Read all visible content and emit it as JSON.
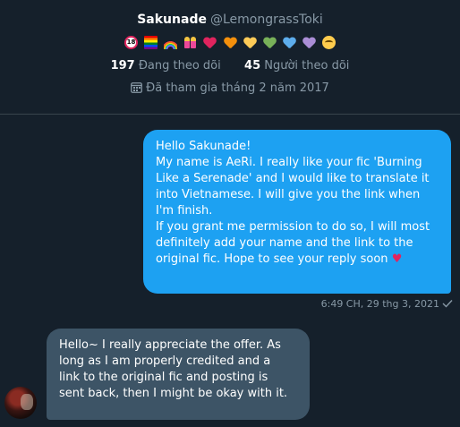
{
  "profile": {
    "display_name": "Sakunade",
    "handle": "@LemongrassToki",
    "bio_emojis": [
      "no-under-18-icon",
      "rainbow-flag-icon",
      "rainbow-icon",
      "couple-icon",
      "red-heart-icon",
      "orange-heart-icon",
      "yellow-heart-icon",
      "green-heart-icon",
      "blue-heart-icon",
      "purple-heart-icon",
      "relieved-face-icon"
    ],
    "following_count": "197",
    "following_label": "Đang theo dõi",
    "followers_count": "45",
    "followers_label": "Người theo dõi",
    "joined": "Đã tham gia tháng 2 năm 2017"
  },
  "conversation": {
    "outgoing": {
      "lines": [
        "Hello Sakunade!",
        "My name is AeRi. I really like your fic 'Burning",
        "Like a Serenade' and I would like to translate it",
        "into Vietnamese. I will give you the link when",
        "I'm finish.",
        "If you grant me permission to do so, I will most",
        "definitely add your name and the link to the",
        "original fic. Hope to see your reply soon"
      ],
      "trailing_emoji": "♥",
      "timestamp": "6:49 CH, 29 thg 3, 2021",
      "status_icon": "check-icon"
    },
    "incoming": {
      "lines": [
        "Hello~ I really appreciate the offer. As",
        "long as I am properly credited and a",
        "link to the original fic and posting is",
        "sent back, then I might be okay with it."
      ]
    }
  },
  "colors": {
    "background": "#15202b",
    "outgoing_bubble": "#1da1f2",
    "incoming_bubble": "#3d5466",
    "muted_text": "#8899a6",
    "heart": "#e0245e"
  }
}
